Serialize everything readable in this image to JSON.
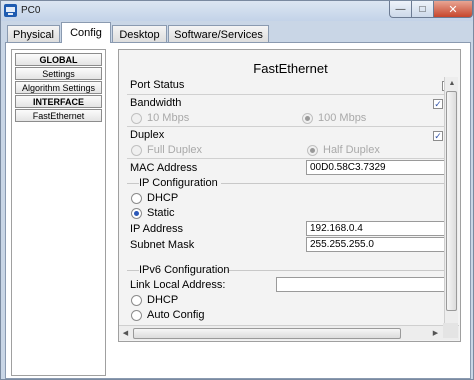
{
  "window": {
    "title": "PC0"
  },
  "tabs": [
    "Physical",
    "Config",
    "Desktop",
    "Software/Services"
  ],
  "nav": {
    "global": "GLOBAL",
    "settings": "Settings",
    "algorithm": "Algorithm Settings",
    "interface": "INTERFACE",
    "fastethernet": "FastEthernet"
  },
  "content": {
    "title": "FastEthernet",
    "port_status": "Port Status",
    "bandwidth": {
      "label": "Bandwidth",
      "checked": true,
      "opt_10": "10 Mbps",
      "opt_100": "100 Mbps"
    },
    "duplex": {
      "label": "Duplex",
      "checked": true,
      "full": "Full Duplex",
      "half": "Half Duplex"
    },
    "mac": {
      "label": "MAC Address",
      "value": "00D0.58C3.7329"
    },
    "ip_config": {
      "title": "IP Configuration",
      "dhcp": "DHCP",
      "static": "Static",
      "ip_label": "IP Address",
      "ip_value": "192.168.0.4",
      "mask_label": "Subnet Mask",
      "mask_value": "255.255.255.0"
    },
    "ipv6": {
      "title": "IPv6 Configuration",
      "link_local_label": "Link Local Address:",
      "link_local_value": "",
      "dhcp": "DHCP",
      "auto": "Auto Config"
    }
  },
  "icons": {
    "app": "packet-tracer-pc-icon",
    "minimize": "minimize-icon",
    "maximize": "maximize-icon",
    "close": "close-icon"
  },
  "colors": {
    "titlebar": "#c9d6e6",
    "close": "#c7462c",
    "radio_selected": "#2b58b8"
  }
}
